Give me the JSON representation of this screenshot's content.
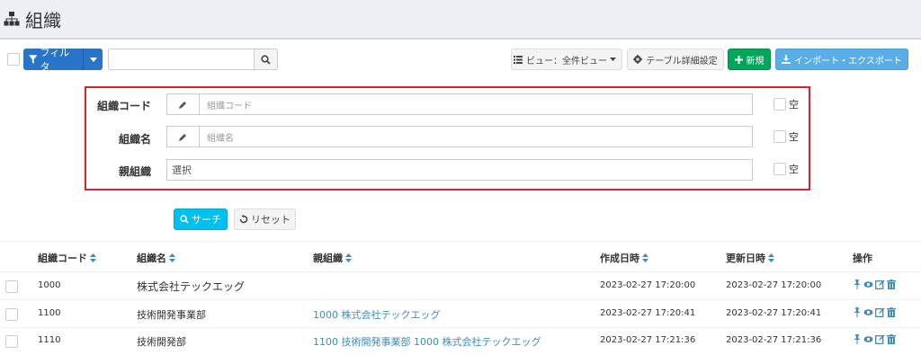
{
  "page": {
    "title": "組織"
  },
  "toolbar": {
    "filter_label": "フィルタ",
    "search_value": "",
    "view_label": "ビュー：全件ビュー",
    "table_settings_label": "テーブル詳細設定",
    "new_label": "新規",
    "import_export_label": "インポート・エクスポート"
  },
  "filter": {
    "fields": [
      {
        "label": "組織コード",
        "placeholder": "組織コード",
        "empty_label": "空"
      },
      {
        "label": "組織名",
        "placeholder": "組織名",
        "empty_label": "空"
      },
      {
        "label": "親組織",
        "value": "選択",
        "empty_label": "空"
      }
    ],
    "search_label": "サーチ",
    "reset_label": "リセット"
  },
  "table": {
    "columns": [
      "組織コード",
      "組織名",
      "親組織",
      "作成日時",
      "更新日時",
      "操作"
    ],
    "rows": [
      {
        "code": "1000",
        "name": "株式会社テックエッグ",
        "parent": "",
        "created": "2023-02-27 17:20:00",
        "updated": "2023-02-27 17:20:00"
      },
      {
        "code": "1100",
        "name": "技術開発事業部",
        "parent": "1000 株式会社テックエッグ",
        "created": "2023-02-27 17:20:41",
        "updated": "2023-02-27 17:20:41"
      },
      {
        "code": "1110",
        "name": "技術開発部",
        "parent": "1100 技術開発事業部 1000 株式会社テックエッグ",
        "created": "2023-02-27 17:21:36",
        "updated": "2023-02-27 17:21:36"
      }
    ]
  },
  "colors": {
    "primary": "#2874c8",
    "success": "#00a65a",
    "info": "#00c0ef",
    "import_export": "#5aaee8",
    "link": "#3c8dbc",
    "highlight_border": "#dd2230"
  },
  "icons": {
    "title": "sitemap-icon",
    "filter": "funnel-icon",
    "search": "search-icon",
    "view": "list-icon",
    "settings": "gear-icon",
    "new": "plus-icon",
    "import_export": "download-icon",
    "pencil": "pencil-icon",
    "reset": "undo-icon",
    "sort": "sort-icon",
    "actions": [
      "pin-icon",
      "eye-icon",
      "edit-icon",
      "trash-icon"
    ]
  }
}
